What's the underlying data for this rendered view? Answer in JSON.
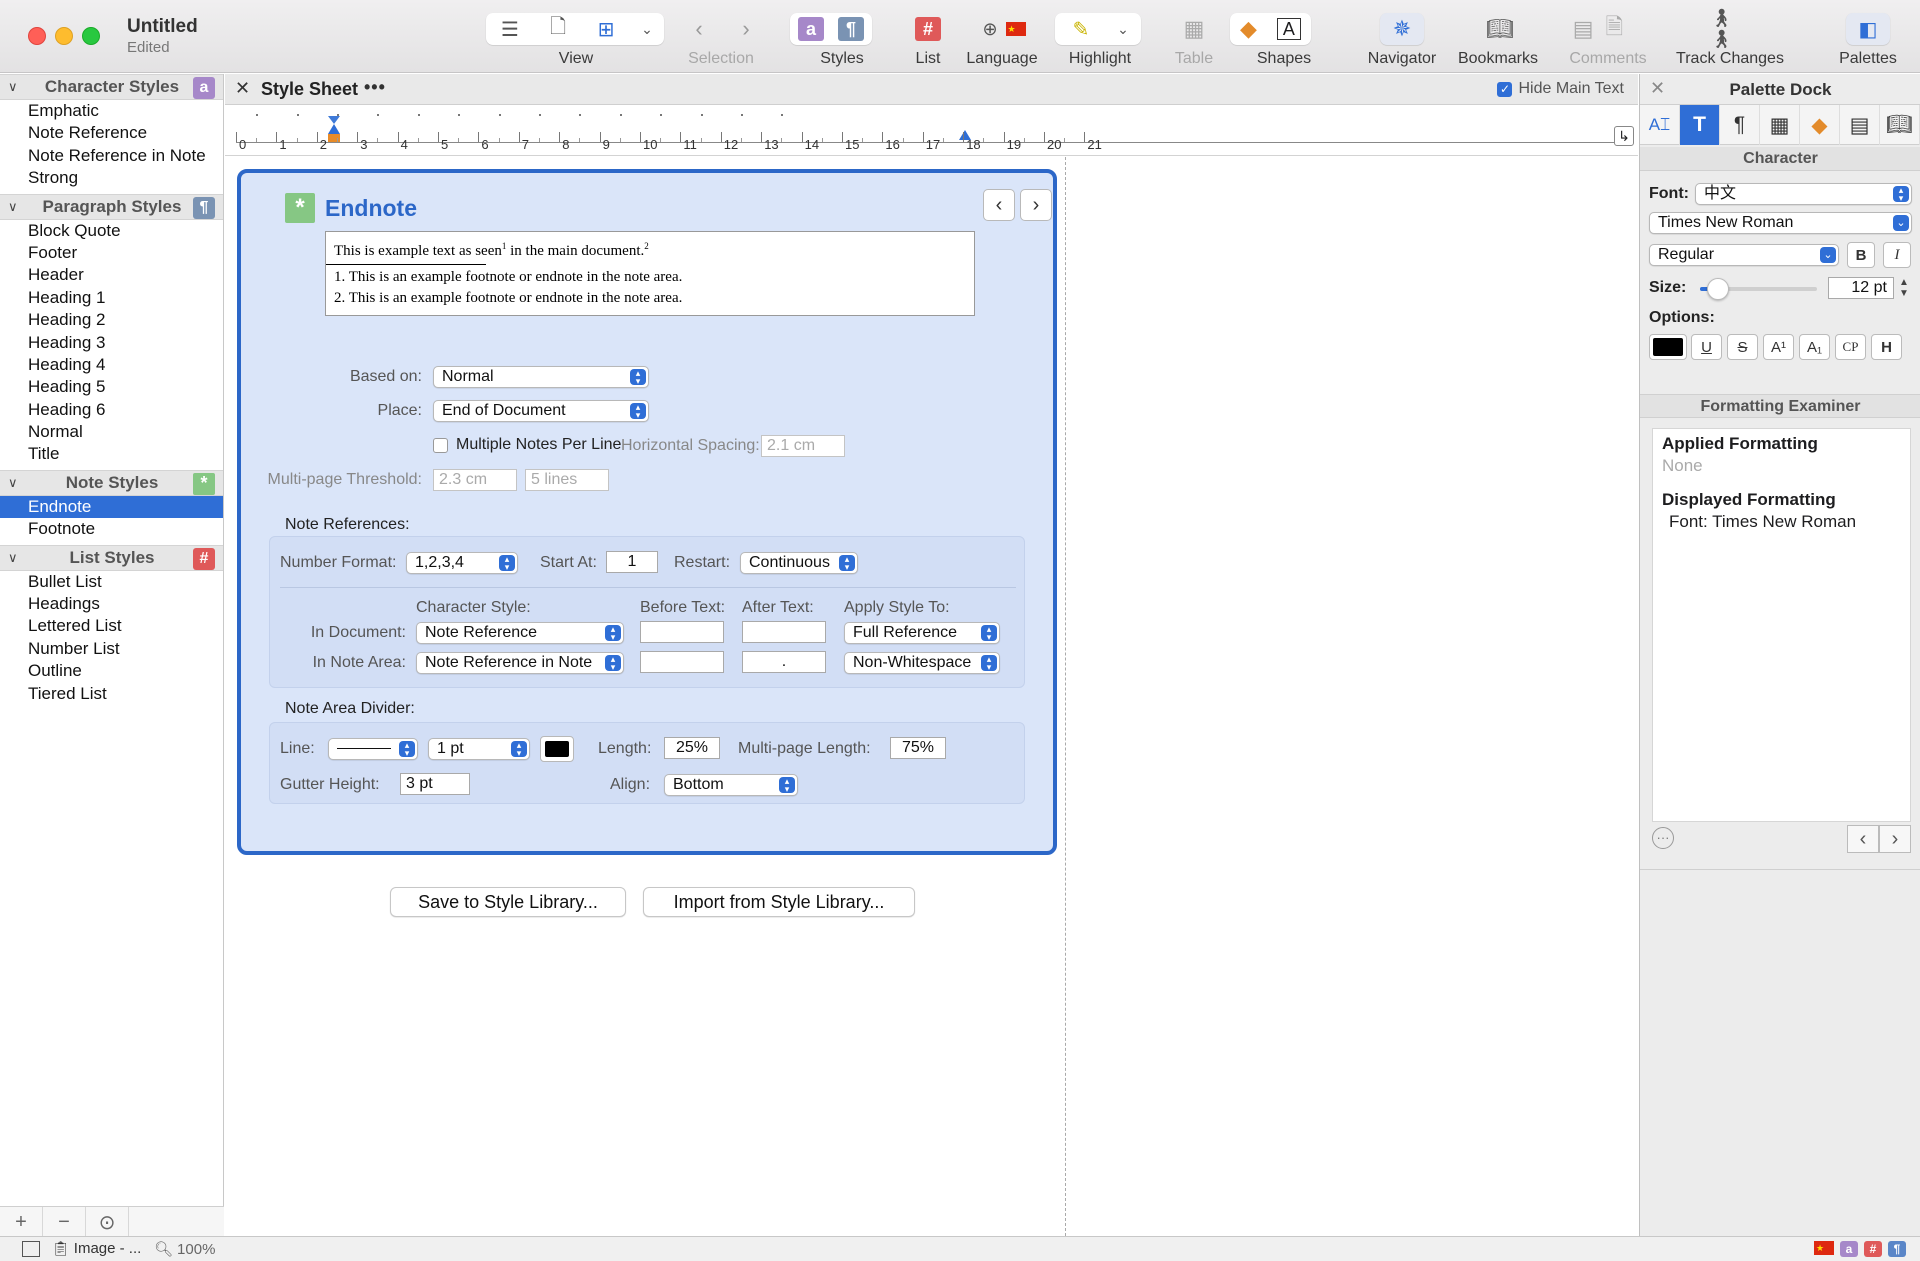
{
  "window": {
    "title": "Untitled",
    "subtitle": "Edited"
  },
  "toolbar": {
    "view_label": "View",
    "selection_label": "Selection",
    "styles_label": "Styles",
    "list_label": "List",
    "language_label": "Language",
    "highlight_label": "Highlight",
    "table_label": "Table",
    "shapes_label": "Shapes",
    "navigator_label": "Navigator",
    "bookmarks_label": "Bookmarks",
    "comments_label": "Comments",
    "track_changes_label": "Track Changes",
    "palettes_label": "Palettes"
  },
  "sidebar": {
    "character_styles": {
      "title": "Character Styles",
      "items": [
        "Emphatic",
        "Note Reference",
        "Note Reference in Note",
        "Strong"
      ]
    },
    "paragraph_styles": {
      "title": "Paragraph Styles",
      "items": [
        "Block Quote",
        "Footer",
        "Header",
        "Heading 1",
        "Heading 2",
        "Heading 3",
        "Heading 4",
        "Heading 5",
        "Heading 6",
        "Normal",
        "Title"
      ]
    },
    "note_styles": {
      "title": "Note Styles",
      "items": [
        "Endnote",
        "Footnote"
      ],
      "selected": "Endnote"
    },
    "list_styles": {
      "title": "List Styles",
      "items": [
        "Bullet List",
        "Headings",
        "Lettered List",
        "Number List",
        "Outline",
        "Tiered List"
      ]
    }
  },
  "tabbar": {
    "title": "Style Sheet",
    "hide_main_text": "Hide Main Text",
    "hide_main_checked": true
  },
  "ruler": {
    "numbers": [
      "0",
      "1",
      "2",
      "3",
      "4",
      "5",
      "6",
      "7",
      "8",
      "9",
      "10",
      "11",
      "12",
      "13",
      "14",
      "15",
      "16",
      "17",
      "18",
      "19",
      "20",
      "21"
    ]
  },
  "editor": {
    "style_name": "Endnote",
    "preview": {
      "line1_a": "This is example text as seen",
      "line1_sup1": "1",
      "line1_b": " in the main document.",
      "line1_sup2": "2",
      "note1": "1. This is an example footnote or endnote in the note area.",
      "note2": "2. This is an example footnote or endnote in the note area."
    },
    "based_on_label": "Based on:",
    "based_on_value": "Normal",
    "place_label": "Place:",
    "place_value": "End of Document",
    "multiple_notes_label": "Multiple Notes Per Line",
    "horizontal_spacing_label": "Horizontal Spacing:",
    "horizontal_spacing_value": "2.1 cm",
    "threshold_label": "Multi-page Threshold:",
    "threshold_cm": "2.3 cm",
    "threshold_lines": "5 lines",
    "note_references_label": "Note References:",
    "number_format_label": "Number Format:",
    "number_format_value": "1,2,3,4",
    "start_at_label": "Start At:",
    "start_at_value": "1",
    "restart_label": "Restart:",
    "restart_value": "Continuous",
    "character_style_header": "Character Style:",
    "before_text_header": "Before Text:",
    "after_text_header": "After Text:",
    "apply_style_header": "Apply Style To:",
    "in_document_label": "In Document:",
    "in_document_style": "Note Reference",
    "in_document_apply": "Full Reference",
    "in_note_area_label": "In Note Area:",
    "in_note_area_style": "Note Reference in Note",
    "in_note_area_after": ".",
    "in_note_area_apply": "Non-Whitespace",
    "divider_label": "Note Area Divider:",
    "line_label": "Line:",
    "line_weight": "1 pt",
    "length_label": "Length:",
    "length_value": "25%",
    "multipage_length_label": "Multi-page Length:",
    "multipage_length_value": "75%",
    "gutter_label": "Gutter Height:",
    "gutter_value": "3 pt",
    "align_label": "Align:",
    "align_value": "Bottom"
  },
  "library": {
    "save": "Save to Style Library...",
    "import": "Import from Style Library..."
  },
  "palette": {
    "title": "Palette Dock",
    "character_header": "Character",
    "font_label": "Font:",
    "font_script": "中文",
    "font_family": "Times New Roman",
    "font_style": "Regular",
    "bold_label": "B",
    "italic_label": "I",
    "size_label": "Size:",
    "size_value": "12 pt",
    "size_fraction": 0.15,
    "options_label": "Options:",
    "options": [
      "U",
      "S",
      "A¹",
      "A₁",
      "CP",
      "H"
    ],
    "exam_header": "Formatting Examiner",
    "applied_title": "Applied Formatting",
    "applied_value": "None",
    "displayed_title": "Displayed Formatting",
    "displayed_value": "Font: Times New Roman"
  },
  "statusbar": {
    "image_label": "Image - ...",
    "zoom": "100%"
  },
  "colors": {
    "accent": "#2f6ed6",
    "panel_bg": "#dae5f9",
    "panel_border": "#2c67c8"
  }
}
